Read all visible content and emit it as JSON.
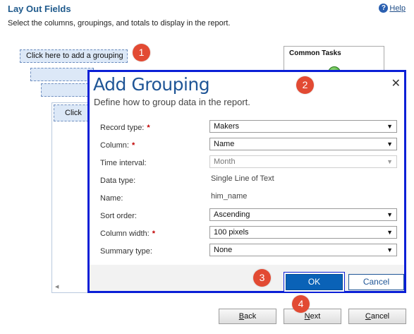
{
  "header": {
    "title": "Lay Out Fields",
    "subtitle": "Select the columns, groupings, and totals to display in the report.",
    "help_label": "Help",
    "help_icon": "?"
  },
  "layout": {
    "add_grouping_label": "Click here to add a grouping",
    "column_label": "Click",
    "scroll_left_glyph": "◀"
  },
  "common_tasks": {
    "title": "Common Tasks"
  },
  "dialog": {
    "title": "Add Grouping",
    "subtitle": "Define how to group data in the report.",
    "close_glyph": "✕",
    "fields": {
      "record_type": {
        "label": "Record type:",
        "value": "Makers"
      },
      "column": {
        "label": "Column:",
        "value": "Name"
      },
      "time_interval": {
        "label": "Time interval:",
        "value": "Month"
      },
      "data_type": {
        "label": "Data type:",
        "value": "Single Line of Text"
      },
      "name": {
        "label": "Name:",
        "value": "him_name"
      },
      "sort_order": {
        "label": "Sort order:",
        "value": "Ascending"
      },
      "column_width": {
        "label": "Column width:",
        "value": "100 pixels"
      },
      "summary_type": {
        "label": "Summary type:",
        "value": "None"
      }
    },
    "required_mark": "*",
    "ok_label": "OK",
    "cancel_label": "Cancel"
  },
  "footer": {
    "back_key": "B",
    "back_rest": "ack",
    "next_key": "N",
    "next_rest": "ext",
    "cancel_key": "C",
    "cancel_rest": "ancel"
  },
  "steps": [
    "1",
    "2",
    "3",
    "4"
  ],
  "colors": {
    "accent": "#0a62b7",
    "dialog_border": "#0a1fd6",
    "step_marker": "#e24a33",
    "title": "#1f5a8c"
  }
}
